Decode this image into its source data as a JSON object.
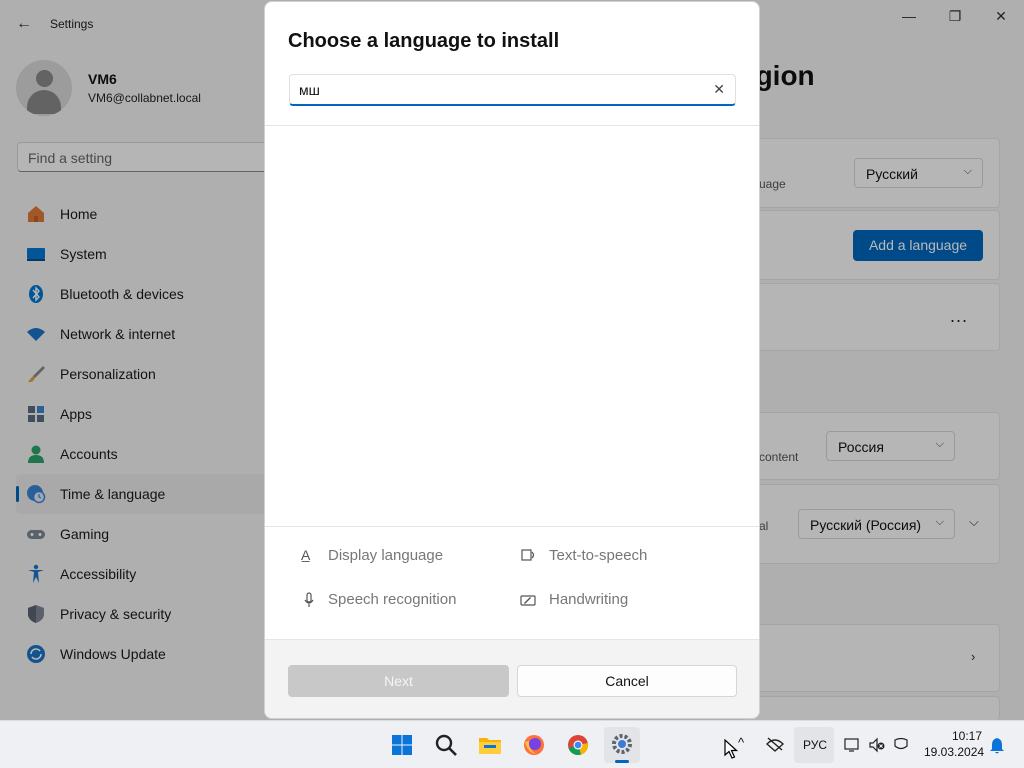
{
  "window": {
    "back_icon": "back-arrow-icon",
    "app_title": "Settings",
    "page_title": "egion"
  },
  "profile": {
    "name": "VM6",
    "email": "VM6@collabnet.local"
  },
  "search": {
    "placeholder": "Find a setting"
  },
  "nav": {
    "items": [
      {
        "label": "Home",
        "icon": "home-icon",
        "active": false
      },
      {
        "label": "System",
        "icon": "system-icon",
        "active": false
      },
      {
        "label": "Bluetooth & devices",
        "icon": "bluetooth-icon",
        "active": false
      },
      {
        "label": "Network & internet",
        "icon": "wifi-icon",
        "active": false
      },
      {
        "label": "Personalization",
        "icon": "brush-icon",
        "active": false
      },
      {
        "label": "Apps",
        "icon": "apps-icon",
        "active": false
      },
      {
        "label": "Accounts",
        "icon": "accounts-icon",
        "active": false
      },
      {
        "label": "Time & language",
        "icon": "clock-globe-icon",
        "active": true
      },
      {
        "label": "Gaming",
        "icon": "gamepad-icon",
        "active": false
      },
      {
        "label": "Accessibility",
        "icon": "accessibility-icon",
        "active": false
      },
      {
        "label": "Privacy & security",
        "icon": "shield-icon",
        "active": false
      },
      {
        "label": "Windows Update",
        "icon": "update-icon",
        "active": false
      }
    ]
  },
  "right_panel": {
    "display_language_hint": "uage",
    "display_language_value": "Русский",
    "add_language_label": "Add a language",
    "more_label": "...",
    "region_hint": "content",
    "country_value": "Россия",
    "format_hint": "al",
    "format_value": "Русский (Россия)"
  },
  "dialog": {
    "title": "Choose a language to install",
    "search_value": "мш",
    "features": {
      "display_language": "Display language",
      "text_to_speech": "Text-to-speech",
      "speech_recognition": "Speech recognition",
      "handwriting": "Handwriting"
    },
    "next_label": "Next",
    "cancel_label": "Cancel"
  },
  "taskbar": {
    "apps": [
      "windows-start-icon",
      "search-icon",
      "file-explorer-icon",
      "firefox-icon",
      "chrome-icon",
      "settings-icon"
    ],
    "input_language": "РУС",
    "time": "10:17",
    "date": "19.03.2024"
  },
  "colors": {
    "accent": "#0067c0",
    "dialog_bg": "#ffffff",
    "overlay": "rgba(0,0,0,0.28)"
  }
}
